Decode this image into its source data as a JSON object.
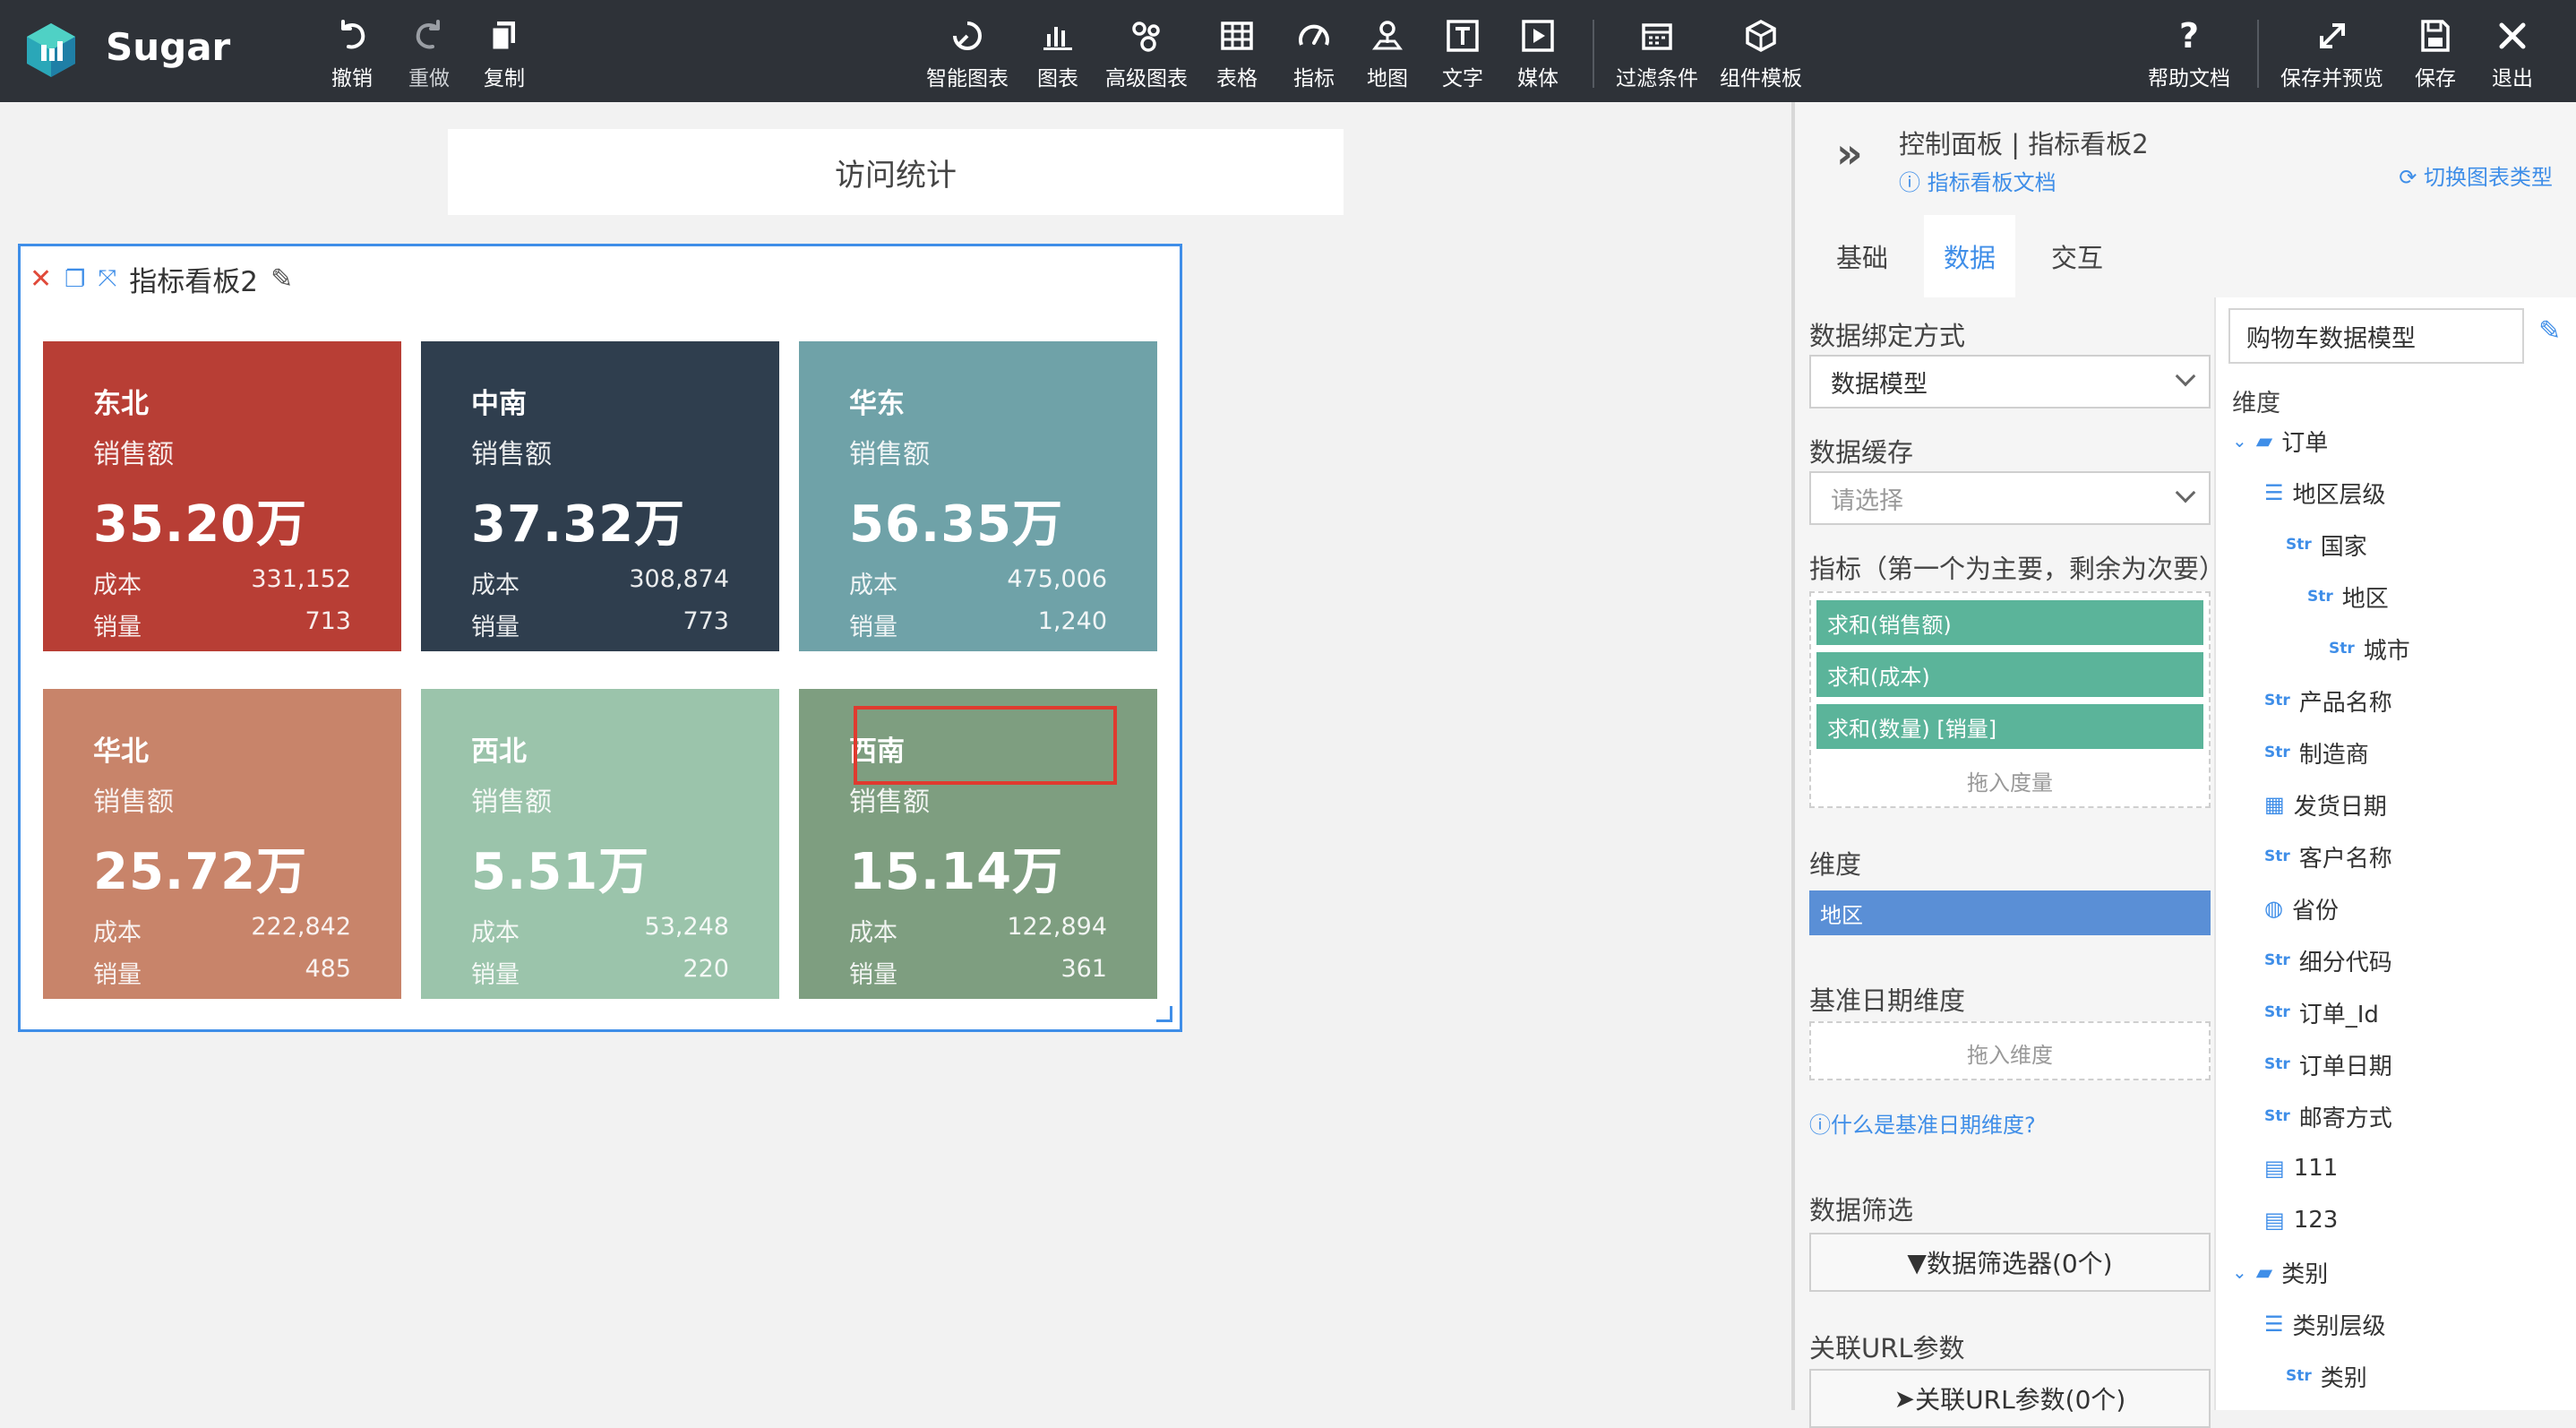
{
  "app": {
    "brand": "Sugar"
  },
  "toolbar": {
    "left": [
      {
        "label": "撤销",
        "icon": "undo-icon"
      },
      {
        "label": "重做",
        "icon": "redo-icon"
      },
      {
        "label": "复制",
        "icon": "copy-icon"
      }
    ],
    "center": [
      {
        "label": "智能图表",
        "icon": "smart-chart-icon"
      },
      {
        "label": "图表",
        "icon": "bar-chart-icon"
      },
      {
        "label": "高级图表",
        "icon": "advanced-chart-icon"
      },
      {
        "label": "表格",
        "icon": "table-icon"
      },
      {
        "label": "指标",
        "icon": "gauge-icon"
      },
      {
        "label": "地图",
        "icon": "map-pin-icon"
      },
      {
        "label": "文字",
        "icon": "text-icon"
      },
      {
        "label": "媒体",
        "icon": "media-icon"
      },
      {
        "label": "过滤条件",
        "icon": "filter-calendar-icon"
      },
      {
        "label": "组件模板",
        "icon": "component-template-icon"
      }
    ],
    "right": [
      {
        "label": "帮助文档",
        "icon": "help-icon"
      },
      {
        "label": "保存并预览",
        "icon": "expand-icon"
      },
      {
        "label": "保存",
        "icon": "save-icon"
      },
      {
        "label": "退出",
        "icon": "close-icon"
      }
    ]
  },
  "canvas": {
    "title": "访问统计"
  },
  "panel": {
    "title": "指标看板2",
    "cards": [
      {
        "region": "东北",
        "metric": "销售额",
        "value": "35.20万",
        "cost_label": "成本",
        "cost": "331,152",
        "qty_label": "销量",
        "qty": "713",
        "color": "#b83e35"
      },
      {
        "region": "中南",
        "metric": "销售额",
        "value": "37.32万",
        "cost_label": "成本",
        "cost": "308,874",
        "qty_label": "销量",
        "qty": "773",
        "color": "#2f3e4e"
      },
      {
        "region": "华东",
        "metric": "销售额",
        "value": "56.35万",
        "cost_label": "成本",
        "cost": "475,006",
        "qty_label": "销量",
        "qty": "1,240",
        "color": "#6fa2a8"
      },
      {
        "region": "华北",
        "metric": "销售额",
        "value": "25.72万",
        "cost_label": "成本",
        "cost": "222,842",
        "qty_label": "销量",
        "qty": "485",
        "color": "#c8846a"
      },
      {
        "region": "西北",
        "metric": "销售额",
        "value": "5.51万",
        "cost_label": "成本",
        "cost": "53,248",
        "qty_label": "销量",
        "qty": "220",
        "color": "#9bc4ab"
      },
      {
        "region": "西南",
        "metric": "销售额",
        "value": "15.14万",
        "cost_label": "成本",
        "cost": "122,894",
        "qty_label": "销量",
        "qty": "361",
        "color": "#7e9e80"
      }
    ]
  },
  "right_panel": {
    "breadcrumb": "控制面板 | 指标看板2",
    "doc_link": "指标看板文档",
    "switch_type": "切换图表类型",
    "tabs": [
      "基础",
      "数据",
      "交互"
    ],
    "active_tab": "数据",
    "binding_label": "数据绑定方式",
    "binding_value": "数据模型",
    "cache_label": "数据缓存",
    "cache_placeholder": "请选择",
    "measures_label": "指标（第一个为主要，剩余为次要）",
    "measures": [
      "求和(销售额)",
      "求和(成本)",
      "求和(数量) [销量]"
    ],
    "measures_hint": "拖入度量",
    "dimension_label": "维度",
    "dimension": "地区",
    "date_dim_label": "基准日期维度",
    "date_dim_hint": "拖入维度",
    "date_dim_help": "什么是基准日期维度?",
    "filter_label": "数据筛选",
    "filter_button": "数据筛选器(0个)",
    "url_label": "关联URL参数",
    "url_button": "关联URL参数(0个)",
    "model_name": "购物车数据模型",
    "fields_label": "维度",
    "fields": [
      {
        "label": "订单",
        "tag": "folder"
      },
      {
        "label": "地区层级",
        "tag": "hier"
      },
      {
        "label": "国家",
        "tag": "Str"
      },
      {
        "label": "地区",
        "tag": "Str"
      },
      {
        "label": "城市",
        "tag": "Str"
      },
      {
        "label": "产品名称",
        "tag": "Str"
      },
      {
        "label": "制造商",
        "tag": "Str"
      },
      {
        "label": "发货日期",
        "tag": "date"
      },
      {
        "label": "客户名称",
        "tag": "Str"
      },
      {
        "label": "省份",
        "tag": "geo"
      },
      {
        "label": "细分代码",
        "tag": "Str"
      },
      {
        "label": "订单_Id",
        "tag": "Str"
      },
      {
        "label": "订单日期",
        "tag": "Str"
      },
      {
        "label": "邮寄方式",
        "tag": "Str"
      },
      {
        "label": "111",
        "tag": "calc"
      },
      {
        "label": "123",
        "tag": "calc"
      },
      {
        "label": "类别",
        "tag": "folder"
      },
      {
        "label": "类别层级",
        "tag": "hier"
      },
      {
        "label": "类别",
        "tag": "Str"
      }
    ]
  }
}
